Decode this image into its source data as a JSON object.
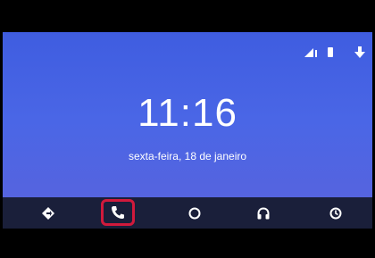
{
  "time": "11:16",
  "date": "sexta-feira, 18 de janeiro",
  "status_icons": [
    "signal-icon",
    "battery-icon",
    "download-icon"
  ],
  "nav": [
    {
      "name": "navigation-icon",
      "selected": false
    },
    {
      "name": "phone-icon",
      "selected": true
    },
    {
      "name": "home-icon",
      "selected": false
    },
    {
      "name": "headphones-icon",
      "selected": false
    },
    {
      "name": "recent-icon",
      "selected": false
    }
  ],
  "colors": {
    "background": "#4a66e6",
    "nav_bar": "#1a1f3a",
    "highlight": "#d11a3c",
    "text": "#ffffff"
  }
}
